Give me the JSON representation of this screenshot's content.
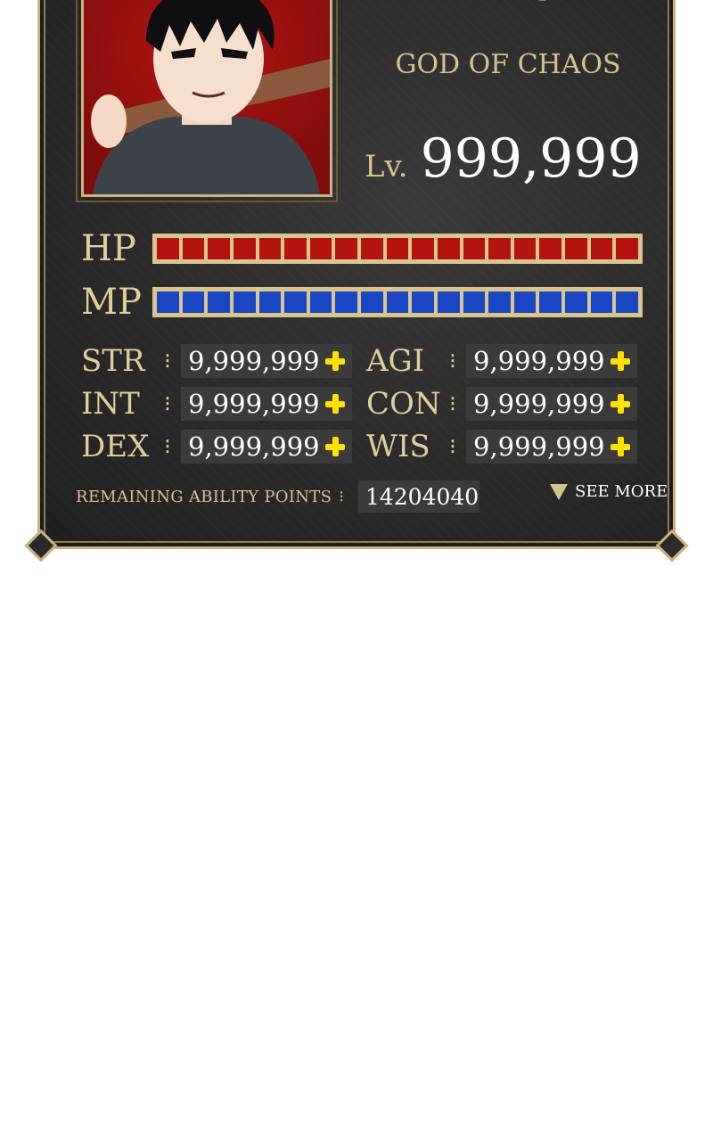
{
  "character": {
    "name": "PEACE",
    "title": "GOD OF CHAOS",
    "level_label": "Lv.",
    "level_value": "999,999"
  },
  "bars": {
    "hp_label": "HP",
    "mp_label": "MP",
    "hp_segments": 19,
    "mp_segments": 19,
    "hp_fill": 1.0,
    "mp_fill": 1.0,
    "hp_color": "#b4140f",
    "mp_color": "#1a46c4"
  },
  "stats": {
    "str": {
      "label": "STR",
      "value": "9,999,999"
    },
    "int": {
      "label": "INT",
      "value": "9,999,999"
    },
    "dex": {
      "label": "DEX",
      "value": "9,999,999"
    },
    "agi": {
      "label": "AGI",
      "value": "9,999,999"
    },
    "con": {
      "label": "CON",
      "value": "9,999,999"
    },
    "wis": {
      "label": "WIS",
      "value": "9,999,999"
    }
  },
  "footer": {
    "remaining_label": "REMAINING ABILITY POINTS",
    "remaining_value": "14204040",
    "see_more_label": "SEE MORE"
  },
  "colors": {
    "frame_gold": "#c9b37e",
    "panel_dark": "#2a2a2a",
    "plus_yellow": "#ffe100"
  },
  "icons": {
    "plus": "plus-icon",
    "see_more": "triangle-down-icon",
    "separator": "colon-dots"
  }
}
